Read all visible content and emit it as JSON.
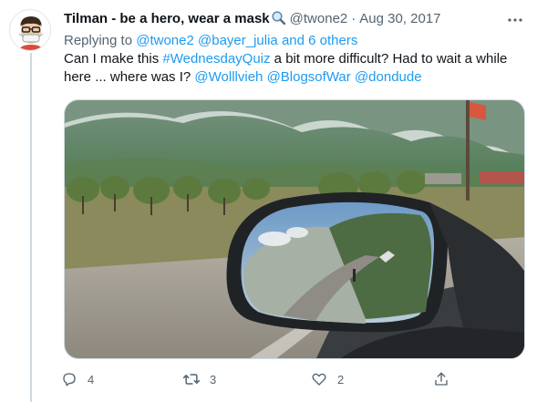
{
  "tweet": {
    "author": {
      "display_name": "Tilman - be a hero, wear a mask",
      "name_emoji": "magnifying-glass",
      "handle": "@twone2",
      "avatar_icon": "masked-man-avatar"
    },
    "separator": "·",
    "date": "Aug 30, 2017",
    "replying_to": {
      "prefix": "Replying to",
      "mentions": [
        "@twone2",
        "@bayer_julia"
      ],
      "joiner": "and",
      "others": "6 others"
    },
    "text": {
      "part1": "Can I make this ",
      "hashtag": "#WednesdayQuiz",
      "part2": " a bit more difficult? Had to wait a while here ... where was I? ",
      "mentions": [
        "@Wolllvieh",
        "@BlogsofWar",
        "@dondude"
      ]
    },
    "media": {
      "description_icon": "car-side-mirror-mountain-road-photo"
    },
    "actions": {
      "reply": {
        "icon": "reply-icon",
        "count": "4"
      },
      "retweet": {
        "icon": "retweet-icon",
        "count": "3"
      },
      "like": {
        "icon": "heart-icon",
        "count": "2"
      },
      "share": {
        "icon": "share-icon"
      }
    },
    "colors": {
      "link": "#1d9bf0",
      "secondary_text": "#536471",
      "primary_text": "#0f1419",
      "thread_line": "#cfd9de"
    }
  }
}
